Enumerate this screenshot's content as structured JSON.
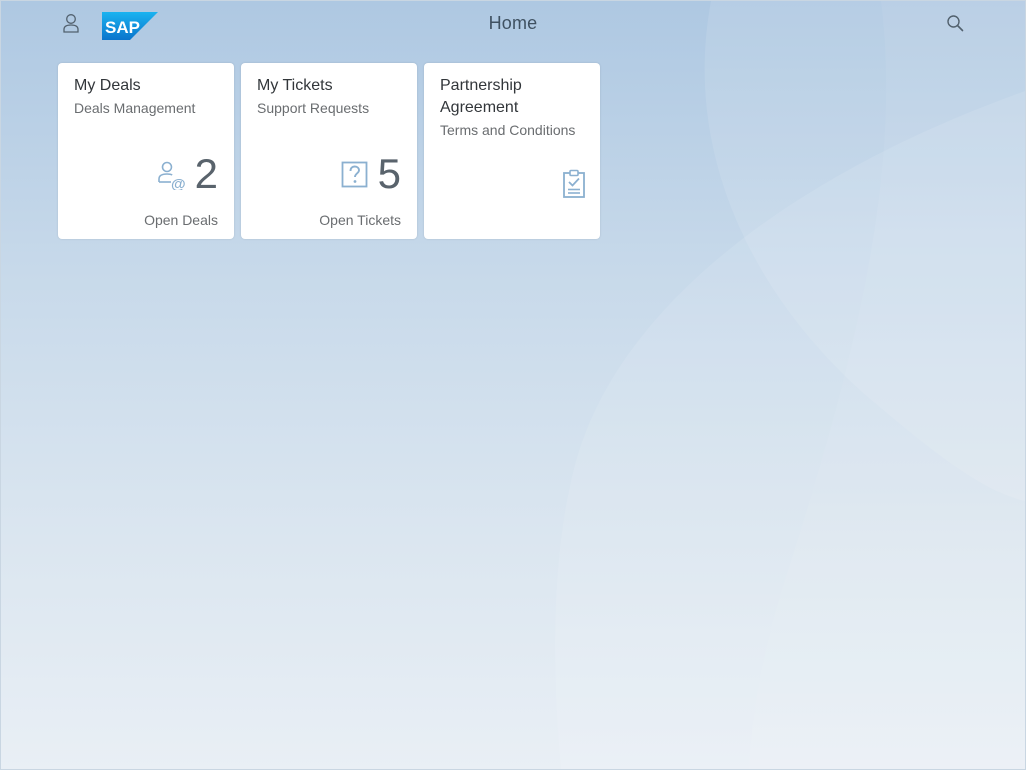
{
  "header": {
    "title": "Home",
    "logo_text": "SAP",
    "user_icon": "user-icon",
    "search_icon": "search-icon"
  },
  "tiles": [
    {
      "title": "My Deals",
      "subtitle": "Deals Management",
      "value": "2",
      "footer": "Open Deals",
      "icon": "person-at-icon"
    },
    {
      "title": "My Tickets",
      "subtitle": "Support Requests",
      "value": "5",
      "footer": "Open Tickets",
      "icon": "question-mark-icon"
    },
    {
      "title": "Partnership Agreement",
      "subtitle": "Terms and Conditions",
      "icon": "clipboard-check-icon"
    }
  ],
  "colors": {
    "accent": "#8bb0d0",
    "logo_blue": "#0a8ae0",
    "kpi_text": "#59636c"
  }
}
